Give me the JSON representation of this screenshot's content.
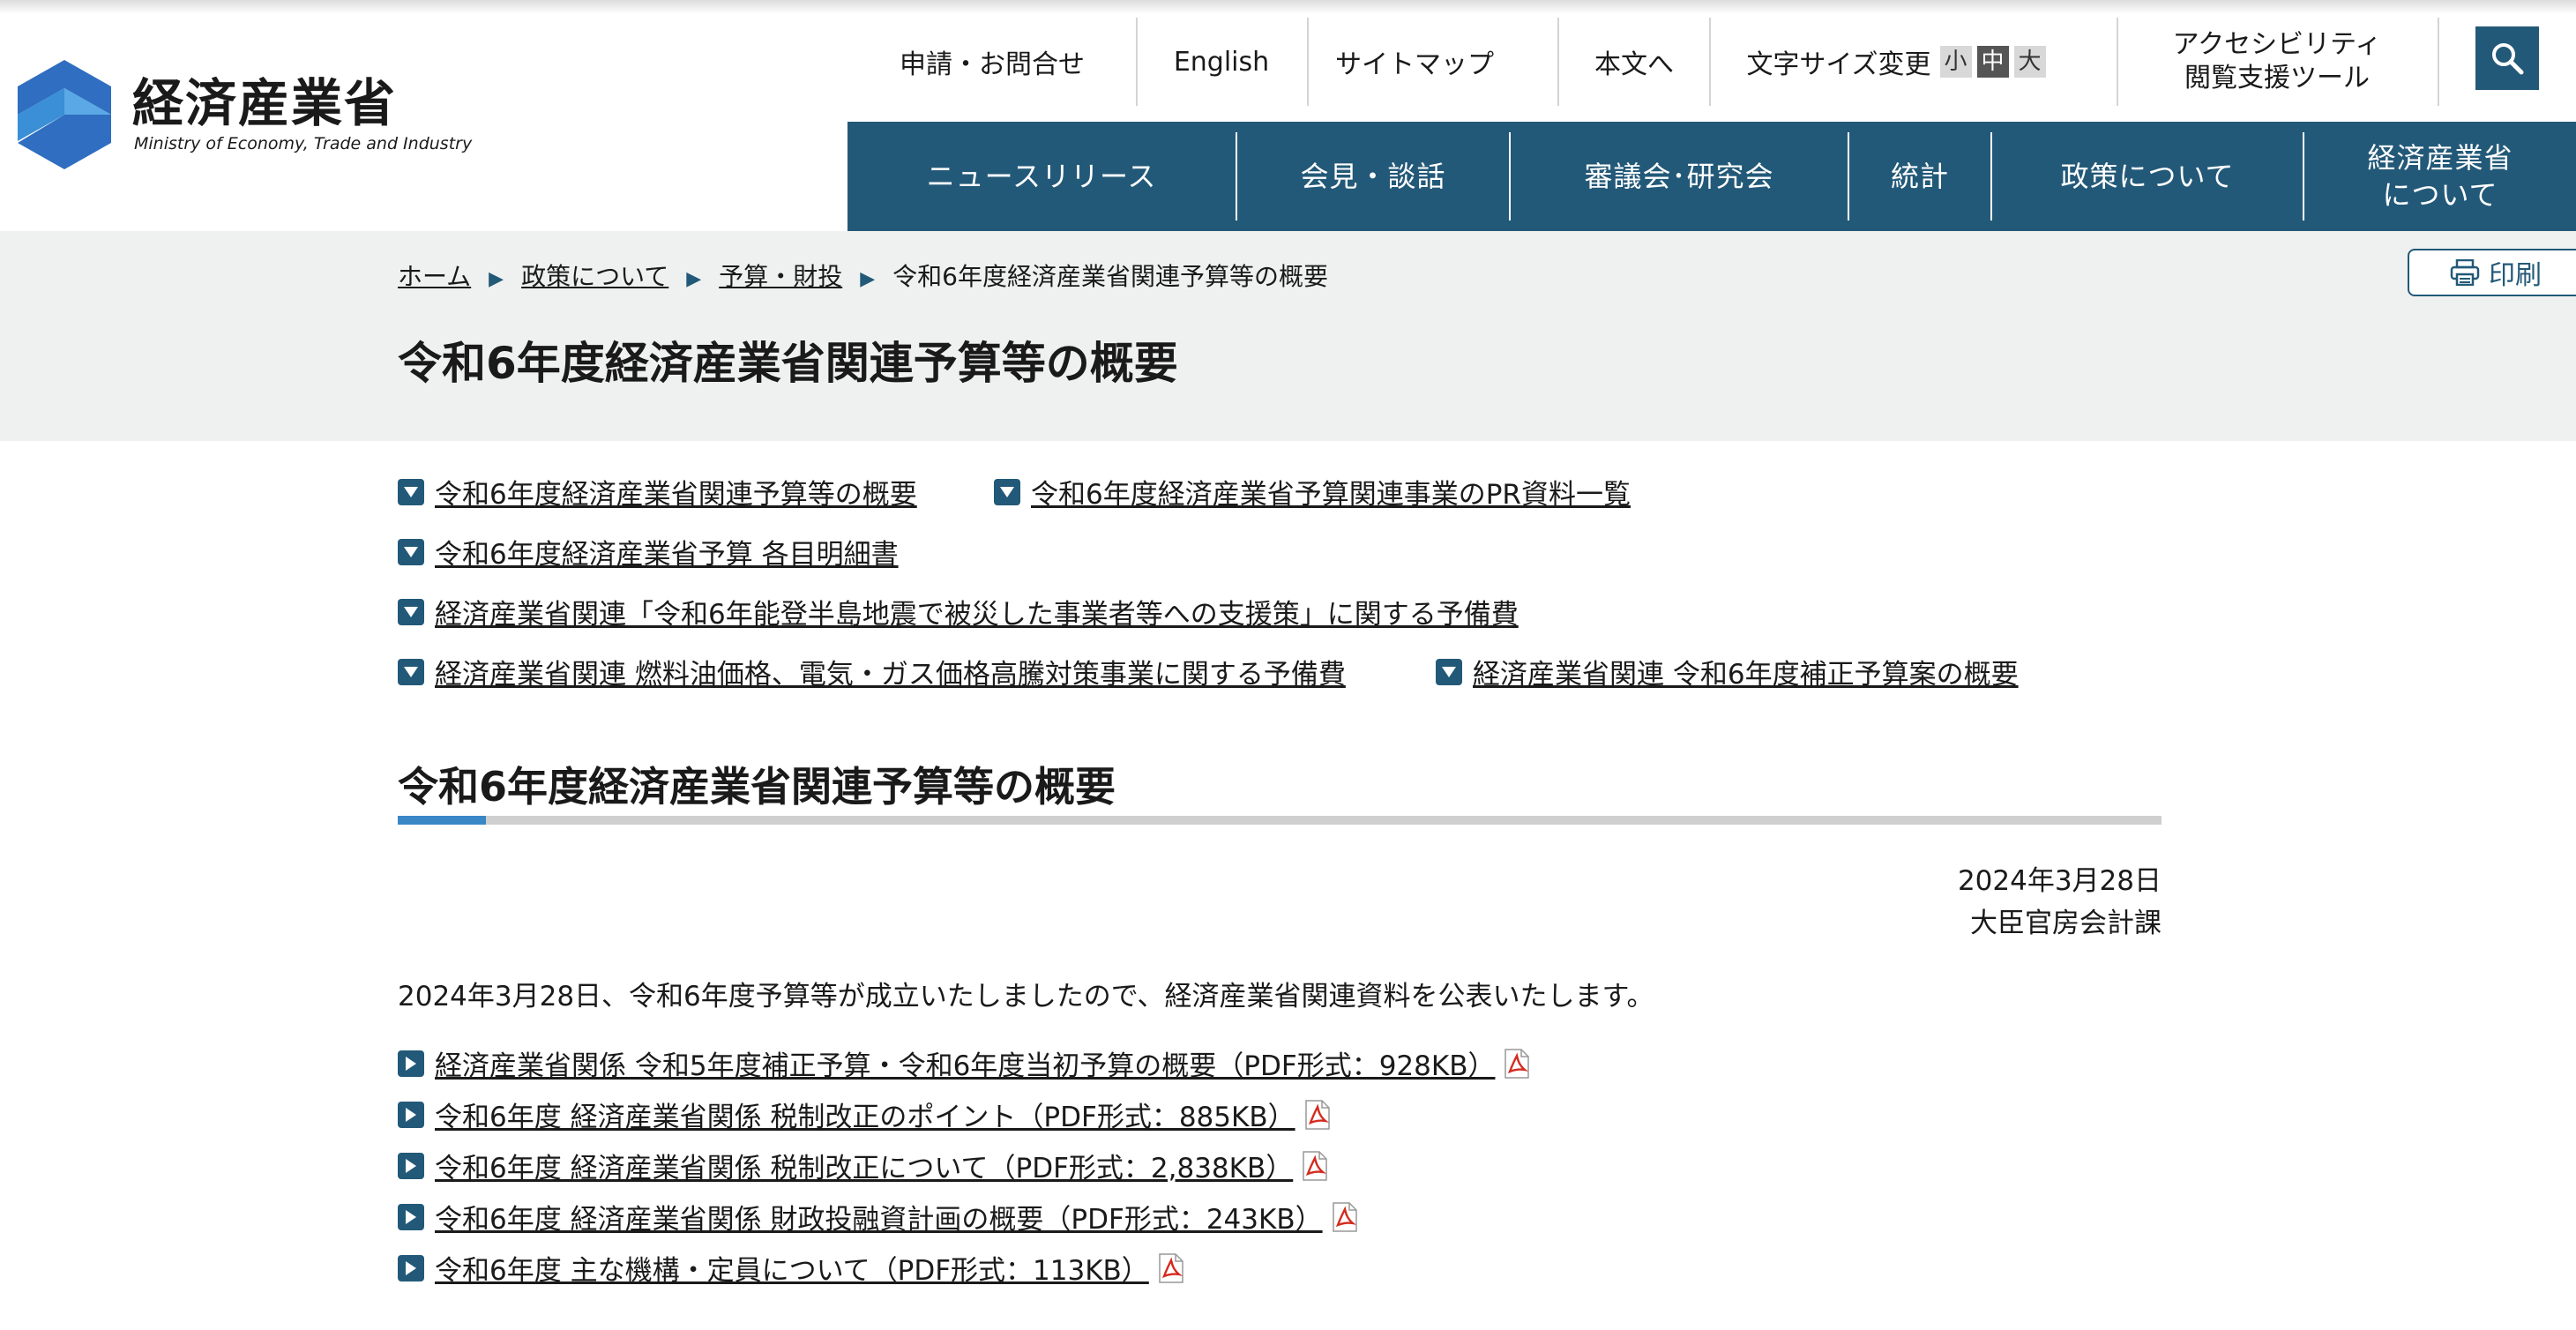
{
  "header": {
    "logo": {
      "title": "経済産業省",
      "subtitle": "Ministry of Economy, Trade and Industry"
    },
    "utility_nav": {
      "contact": "申請・お問合せ",
      "english": "English",
      "sitemap": "サイトマップ",
      "main_content": "本文へ",
      "font_size_label": "文字サイズ変更",
      "font_sizes": {
        "small": "小",
        "medium": "中",
        "large": "大"
      },
      "accessibility_line1": "アクセシビリティ",
      "accessibility_line2": "閲覧支援ツール"
    },
    "main_nav": {
      "news": "ニュースリリース",
      "press": "会見・談話",
      "councils": "審議会･研究会",
      "statistics": "統計",
      "policy": "政策について",
      "about_line1": "経済産業省",
      "about_line2": "について"
    }
  },
  "breadcrumb": {
    "home": "ホーム",
    "policy": "政策について",
    "budget": "予算・財投",
    "current": "令和6年度経済産業省関連予算等の概要"
  },
  "print_label": "印刷",
  "page_title": "令和6年度経済産業省関連予算等の概要",
  "anchors": {
    "overview": "令和6年度経済産業省関連予算等の概要",
    "pr_materials": "令和6年度経済産業省予算関連事業のPR資料一覧",
    "itemized": "令和6年度経済産業省予算 各目明細書",
    "noto_reserve": "経済産業省関連「令和6年能登半島地震で被災した事業者等への支援策」に関する予備費",
    "fuel_reserve": "経済産業省関連 燃料油価格、電気・ガス価格高騰対策事業に関する予備費",
    "supplementary": "経済産業省関連 令和6年度補正予算案の概要"
  },
  "section": {
    "heading": "令和6年度経済産業省関連予算等の概要",
    "date": "2024年3月28日",
    "department": "大臣官房会計課",
    "intro": "2024年3月28日、令和6年度予算等が成立いたしましたので、経済産業省関連資料を公表いたします。",
    "documents": [
      {
        "label": "経済産業省関係 令和5年度補正予算・令和6年度当初予算の概要（PDF形式：928KB）"
      },
      {
        "label": "令和6年度 経済産業省関係 税制改正のポイント（PDF形式：885KB）"
      },
      {
        "label": "令和6年度 経済産業省関係 税制改正について（PDF形式：2,838KB）"
      },
      {
        "label": "令和6年度 経済産業省関係 財政投融資計画の概要（PDF形式：243KB）"
      },
      {
        "label": "令和6年度 主な機構・定員について（PDF形式：113KB）"
      }
    ]
  },
  "colors": {
    "brand": "#235978",
    "accent": "#3a87c6",
    "band": "#eff1f0",
    "pdf": "#d42b1e"
  },
  "icons": [
    "search-icon",
    "printer-icon",
    "triangle-down-icon",
    "triangle-right-icon",
    "pdf-icon"
  ]
}
